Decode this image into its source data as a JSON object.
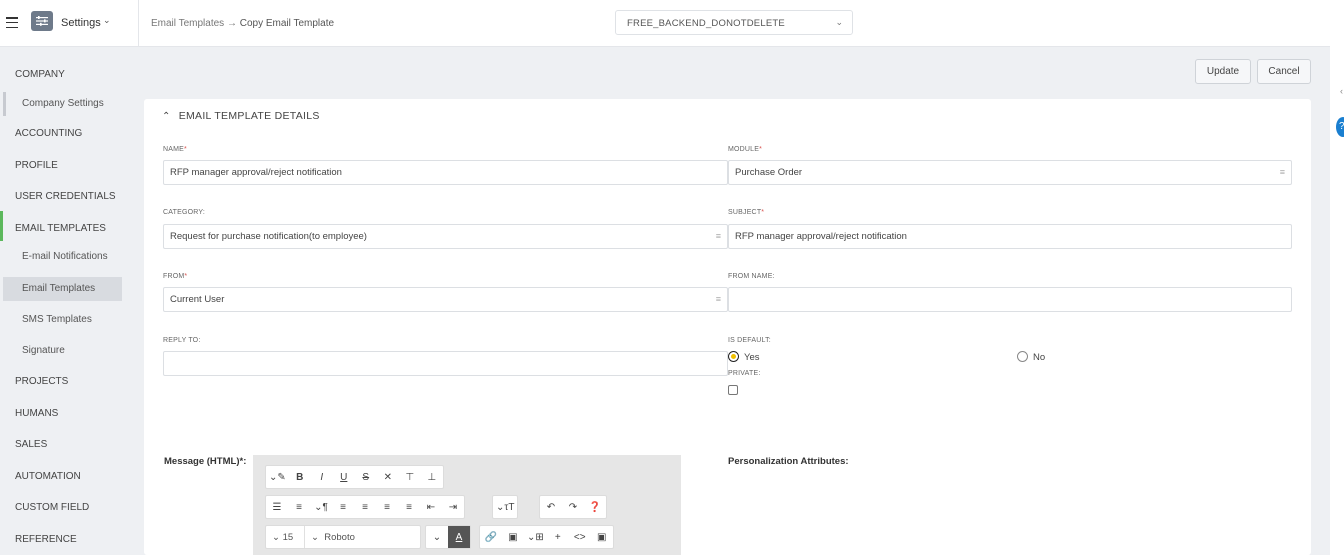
{
  "header": {
    "settings_label": "Settings",
    "breadcrumb_parent": "Email Templates",
    "breadcrumb_sep": "→",
    "breadcrumb_current": "Copy Email Template",
    "environment": "FREE_BACKEND_DONOTDELETE"
  },
  "sidebar": {
    "items": [
      {
        "label": "COMPANY"
      },
      {
        "label": "Company Settings"
      },
      {
        "label": "ACCOUNTING"
      },
      {
        "label": "PROFILE"
      },
      {
        "label": "USER CREDENTIALS"
      },
      {
        "label": "EMAIL TEMPLATES"
      },
      {
        "label": "E-mail Notifications"
      },
      {
        "label": "Email Templates"
      },
      {
        "label": "SMS Templates"
      },
      {
        "label": "Signature"
      },
      {
        "label": "PROJECTS"
      },
      {
        "label": "HUMANS"
      },
      {
        "label": "SALES"
      },
      {
        "label": "AUTOMATION"
      },
      {
        "label": "CUSTOM FIELD"
      },
      {
        "label": "REFERENCE"
      }
    ]
  },
  "actions": {
    "update": "Update",
    "cancel": "Cancel"
  },
  "form": {
    "section_title": "EMAIL TEMPLATE DETAILS",
    "name_label": "NAME",
    "name_value": "RFP manager approval/reject notification",
    "module_label": "MODULE",
    "module_value": "Purchase Order",
    "category_label": "CATEGORY:",
    "category_value": "Request for purchase notification(to employee)",
    "subject_label": "SUBJECT",
    "subject_value": "RFP manager approval/reject notification",
    "from_label": "FROM",
    "from_value": "Current User",
    "from_name_label": "FROM NAME:",
    "from_name_value": "",
    "reply_to_label": "REPLY TO:",
    "reply_to_value": "",
    "is_default_label": "IS DEFAULT:",
    "yes_label": "Yes",
    "no_label": "No",
    "private_label": "PRIVATE:",
    "required_mark": "*",
    "message_label": "Message (HTML)",
    "message_suffix": ":",
    "personalization_label": "Personalization Attributes:"
  },
  "editor": {
    "font_size": "15",
    "font_family": "Roboto"
  },
  "colors": {
    "accent_green": "#5cb85c",
    "radio_yellow": "#f0c000",
    "required_red": "#d9534f"
  }
}
